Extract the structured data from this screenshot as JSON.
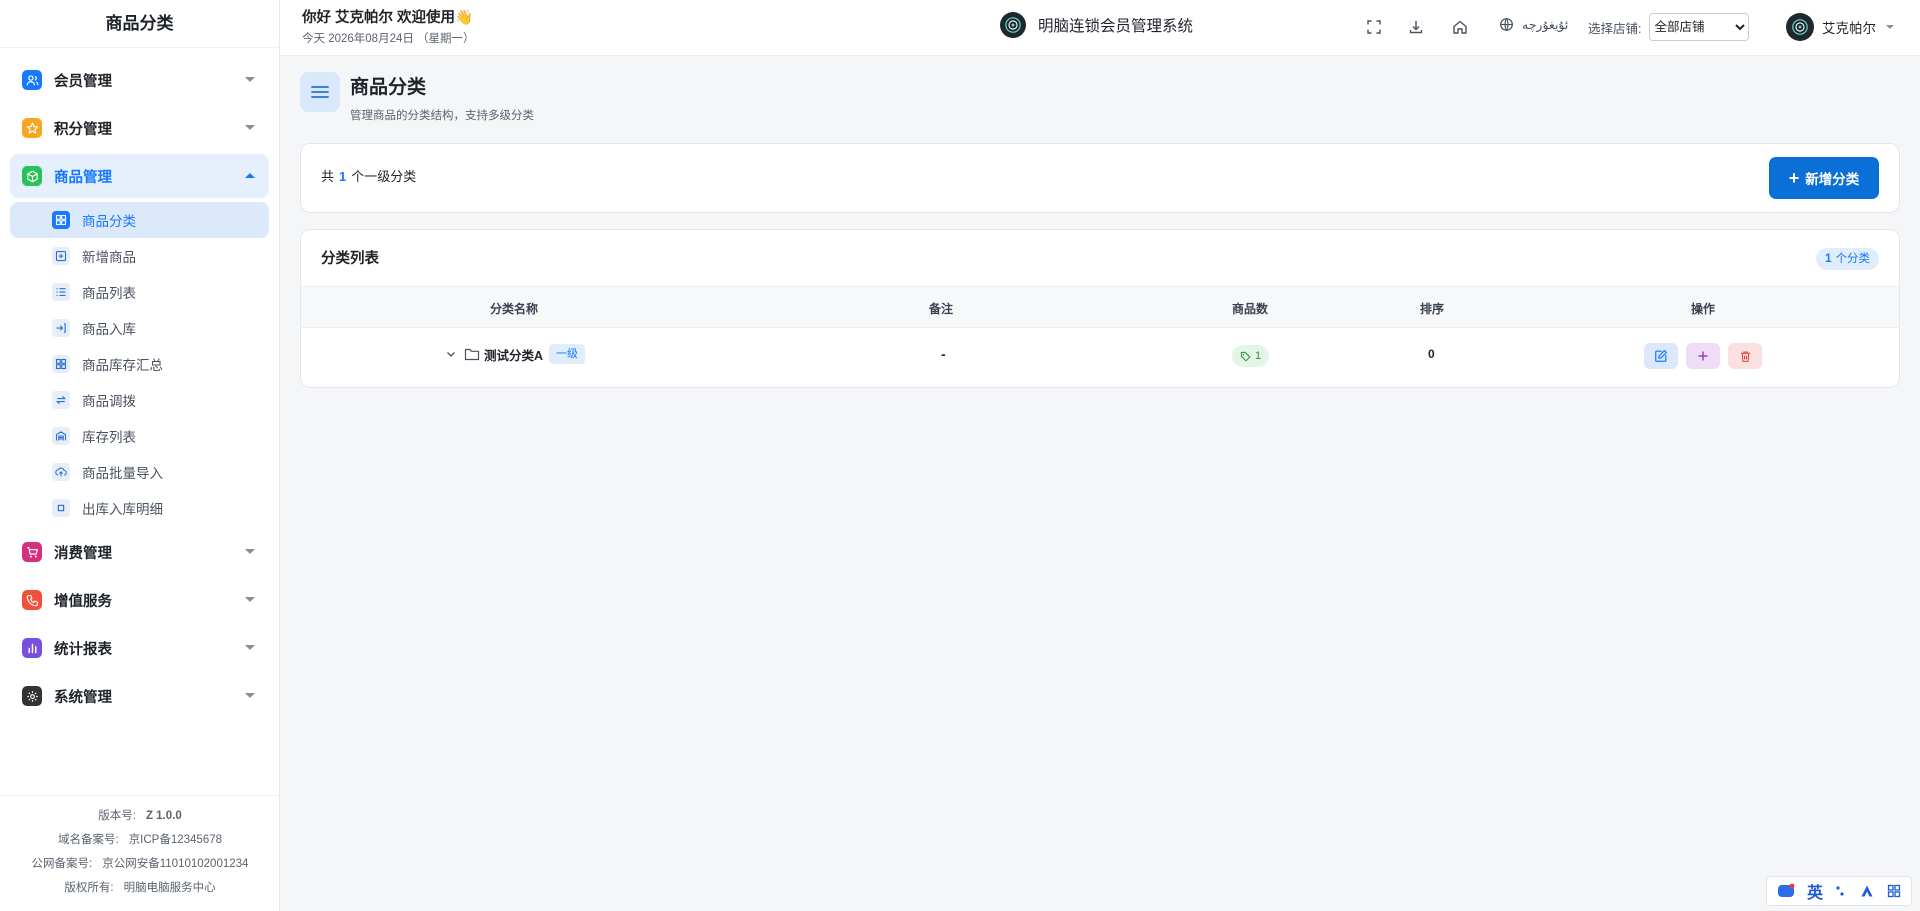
{
  "sidebar": {
    "title": "商品分类",
    "groups": [
      {
        "label": "会员管理",
        "icon": "users-icon",
        "color": "#1677ff"
      },
      {
        "label": "积分管理",
        "icon": "star-icon",
        "color": "#f5a623"
      },
      {
        "label": "商品管理",
        "icon": "cube-icon",
        "color": "#27c25a"
      },
      {
        "label": "消费管理",
        "icon": "cart-icon",
        "color": "#d4307f"
      },
      {
        "label": "增值服务",
        "icon": "phone-icon",
        "color": "#f0503c"
      },
      {
        "label": "统计报表",
        "icon": "bar-chart-icon",
        "color": "#7a4fe0"
      },
      {
        "label": "系统管理",
        "icon": "gear-icon",
        "color": "#333333"
      }
    ],
    "sub_items": [
      {
        "label": "商品分类",
        "icon": "grid-icon"
      },
      {
        "label": "新增商品",
        "icon": "plus-square-icon"
      },
      {
        "label": "商品列表",
        "icon": "list-icon"
      },
      {
        "label": "商品入库",
        "icon": "import-icon"
      },
      {
        "label": "商品库存汇总",
        "icon": "grid-icon"
      },
      {
        "label": "商品调拨",
        "icon": "swap-icon"
      },
      {
        "label": "库存列表",
        "icon": "warehouse-icon"
      },
      {
        "label": "商品批量导入",
        "icon": "upload-icon"
      },
      {
        "label": "出库入库明细",
        "icon": "square-icon"
      }
    ],
    "footer": {
      "version_label": "版本号:",
      "version": "Z 1.0.0",
      "icp_label": "域名备案号:",
      "icp": "京ICP备12345678",
      "police_label": "公网备案号:",
      "police": "京公网安备11010102001234",
      "copyright_label": "版权所有:",
      "copyright": "明脑电脑服务中心"
    }
  },
  "header": {
    "greeting": "你好 艾克帕尔 欢迎使用👋",
    "date": "今天 2026年08月24日 （星期一）",
    "brand": "明脑连锁会员管理系统",
    "language": "ئۇيغۇرچە",
    "store_label": "选择店铺:",
    "store_value": "全部店铺",
    "user_name": "艾克帕尔"
  },
  "page": {
    "title": "商品分类",
    "subtitle": "管理商品的分类结构，支持多级分类"
  },
  "summary": {
    "prefix": "共",
    "count": "1",
    "suffix": "个一级分类",
    "add_button": "新增分类"
  },
  "table": {
    "title": "分类列表",
    "badge_count": "1",
    "badge_suffix": "个分类",
    "columns": [
      "分类名称",
      "备注",
      "商品数",
      "排序",
      "操作"
    ],
    "rows": [
      {
        "name": "测试分类A",
        "level": "一级",
        "remark": "-",
        "count": "1",
        "sort": "0"
      }
    ]
  },
  "ime": {
    "lang": "英"
  }
}
